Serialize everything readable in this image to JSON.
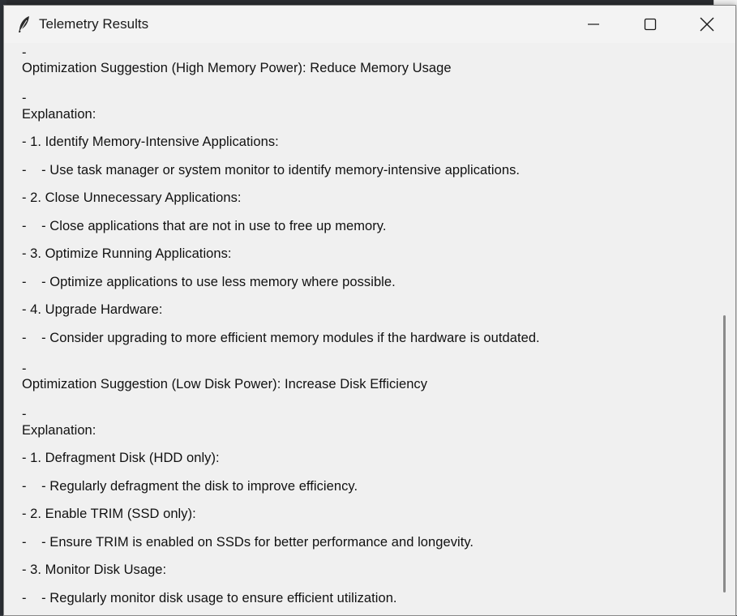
{
  "window": {
    "title": "Telemetry Results",
    "controls": {
      "minimize_icon": "minimize-icon",
      "maximize_icon": "maximize-icon",
      "close_icon": "close-icon"
    },
    "app_icon": "feather-icon"
  },
  "content": {
    "lines": [
      "-",
      "Optimization Suggestion (High Memory Power): Reduce Memory Usage",
      "-",
      "Explanation:",
      "- 1. Identify Memory-Intensive Applications:",
      "-    - Use task manager or system monitor to identify memory-intensive applications.",
      "- 2. Close Unnecessary Applications:",
      "-    - Close applications that are not in use to free up memory.",
      "- 3. Optimize Running Applications:",
      "-    - Optimize applications to use less memory where possible.",
      "- 4. Upgrade Hardware:",
      "-    - Consider upgrading to more efficient memory modules if the hardware is outdated.",
      "-",
      "Optimization Suggestion (Low Disk Power): Increase Disk Efficiency",
      "-",
      "Explanation:",
      "- 1. Defragment Disk (HDD only):",
      "-    - Regularly defragment the disk to improve efficiency.",
      "- 2. Enable TRIM (SSD only):",
      "-    - Ensure TRIM is enabled on SSDs for better performance and longevity.",
      "- 3. Monitor Disk Usage:",
      "-    - Regularly monitor disk usage to ensure efficient utilization."
    ]
  }
}
